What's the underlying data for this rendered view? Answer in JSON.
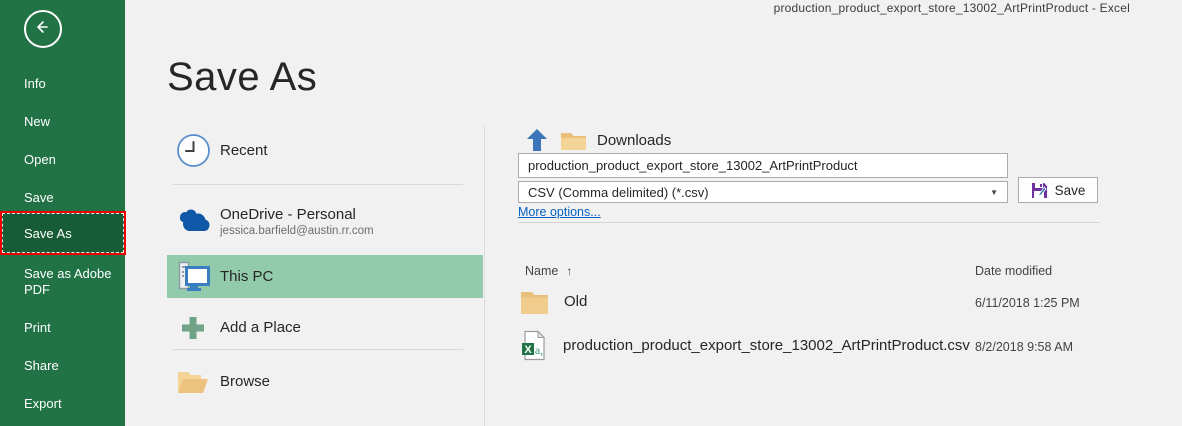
{
  "titlebar": {
    "title": "production_product_export_store_13002_ArtPrintProduct  -  Excel"
  },
  "sidebar": {
    "items": [
      {
        "label": "Info"
      },
      {
        "label": "New"
      },
      {
        "label": "Open"
      },
      {
        "label": "Save"
      },
      {
        "label": "Save As"
      },
      {
        "label": "Save as Adobe PDF"
      },
      {
        "label": "Print"
      },
      {
        "label": "Share"
      },
      {
        "label": "Export"
      }
    ]
  },
  "page": {
    "title": "Save As"
  },
  "places": {
    "recent": {
      "label": "Recent"
    },
    "onedrive": {
      "label": "OneDrive - Personal",
      "email": "jessica.barfield@austin.rr.com"
    },
    "this_pc": {
      "label": "This PC"
    },
    "add_place": {
      "label": "Add a Place"
    },
    "browse": {
      "label": "Browse"
    }
  },
  "save_panel": {
    "location": "Downloads",
    "filename": "production_product_export_store_13002_ArtPrintProduct",
    "filetype": "CSV (Comma delimited) (*.csv)",
    "save_label": "Save",
    "more_options": "More options...",
    "columns": {
      "name": "Name",
      "date": "Date modified"
    },
    "files": [
      {
        "name": "Old",
        "type": "folder",
        "date": "6/11/2018 1:25 PM"
      },
      {
        "name": "production_product_export_store_13002_ArtPrintProduct.csv",
        "type": "csv",
        "date": "8/2/2018 9:58 AM"
      }
    ]
  },
  "icons": {
    "sort_asc": "↑",
    "caret": "▼"
  },
  "colors": {
    "sidebar_green": "#217346",
    "sidebar_selected": "#185c37",
    "annotation_red": "#ee0000",
    "place_selected": "#92cbac",
    "link_blue": "#0563c1",
    "arrow_blue": "#3b76b8",
    "onedrive_blue": "#0f58a8",
    "folder_tan": "#efc981",
    "excel_green": "#217346",
    "save_icon_purple": "#7030a0"
  }
}
